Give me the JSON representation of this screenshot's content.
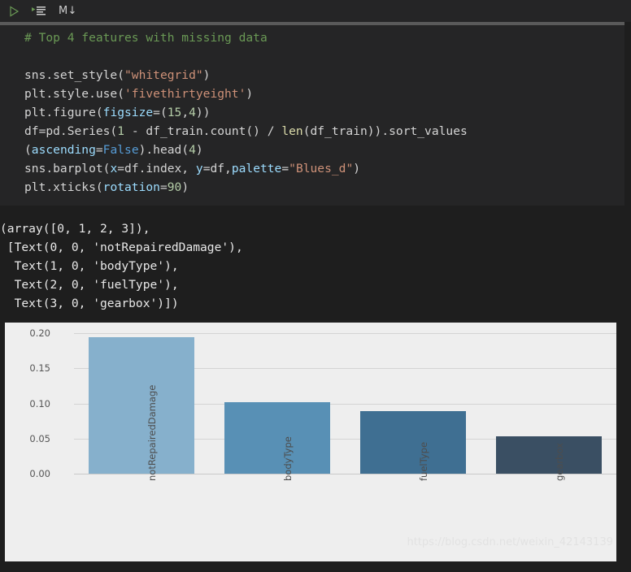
{
  "toolbar": {
    "run_cell": "run-cell",
    "run_all": "run-all-cells",
    "markdown_label": "M↓"
  },
  "code_cell": {
    "lines": [
      "# Top 4 features with missing data",
      "",
      "sns.set_style(\"whitegrid\")",
      "plt.style.use('fivethirtyeight')",
      "plt.figure(figsize=(15,4))",
      "df=pd.Series(1 - df_train.count() / len(df_train)).sort_values",
      "(ascending=False).head(4)",
      "sns.barplot(x=df.index, y=df,palette=\"Blues_d\")",
      "plt.xticks(rotation=90)"
    ],
    "tokens": {
      "comment": "# Top 4 features with missing data",
      "l3_a": "sns.set_style(",
      "l3_str": "\"whitegrid\"",
      "l3_b": ")",
      "l4_a": "plt.style.use(",
      "l4_str": "'fivethirtyeight'",
      "l4_b": ")",
      "l5_a": "plt.figure(",
      "l5_param": "figsize",
      "l5_eq": "=(",
      "l5_n1": "15",
      "l5_comma": ",",
      "l5_n2": "4",
      "l5_b": "))",
      "l6_a": "df=pd.Series(",
      "l6_n": "1",
      "l6_b": " - df_train.count() / ",
      "l6_fn": "len",
      "l6_c": "(df_train)).sort_values",
      "l7_a": "(",
      "l7_param": "ascending",
      "l7_eq": "=",
      "l7_kw": "False",
      "l7_b": ").head(",
      "l7_n": "4",
      "l7_c": ")",
      "l8_a": "sns.barplot(",
      "l8_x": "x",
      "l8_b": "=df.index, ",
      "l8_y": "y",
      "l8_c": "=df,",
      "l8_palette": "palette",
      "l8_eq": "=",
      "l8_str": "\"Blues_d\"",
      "l8_d": ")",
      "l9_a": "plt.xticks(",
      "l9_param": "rotation",
      "l9_eq": "=",
      "l9_n": "90",
      "l9_b": ")"
    }
  },
  "output_text": "(array([0, 1, 2, 3]),\n [Text(0, 0, 'notRepairedDamage'),\n  Text(1, 0, 'bodyType'),\n  Text(2, 0, 'fuelType'),\n  Text(3, 0, 'gearbox')])",
  "figure": {
    "watermark": "https://blog.csdn.net/weixin_42143139"
  },
  "chart_data": {
    "type": "bar",
    "title": "",
    "xlabel": "",
    "ylabel": "",
    "categories": [
      "notRepairedDamage",
      "bodyType",
      "fuelType",
      "gearbox"
    ],
    "values": [
      0.194,
      0.102,
      0.089,
      0.053
    ],
    "ylim": [
      0.0,
      0.2
    ],
    "yticks": [
      "0.00",
      "0.05",
      "0.10",
      "0.15",
      "0.20"
    ],
    "ytick_values": [
      0.0,
      0.05,
      0.1,
      0.15,
      0.2
    ],
    "grid": true,
    "legend": false,
    "xtick_rotation": 90,
    "palette": "Blues_d",
    "bar_colors": [
      "#86b0cc",
      "#5890b5",
      "#3f6f92",
      "#3a4f63"
    ],
    "background": "#eeeeee"
  }
}
